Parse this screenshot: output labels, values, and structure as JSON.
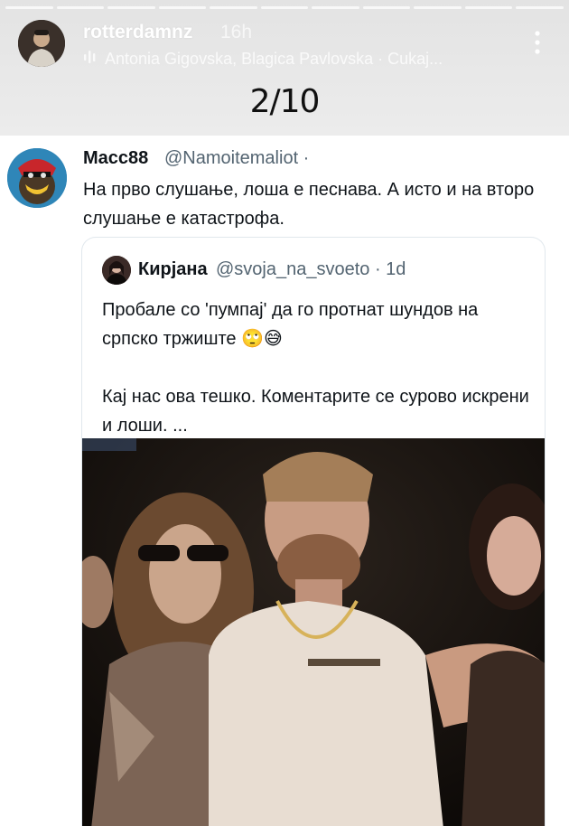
{
  "story": {
    "progress_segments": 11,
    "username": "rotterdamnz",
    "time": "16h",
    "music": "Antonia Gigovska, Blagica Pavlovska · Cukaj...",
    "counter": "2/10"
  },
  "tweet": {
    "display_name": "Macc88",
    "handle": "@Namoitemaliot ·",
    "text": "На прво слушање, лоша е песнава. А исто и на второ слушање е катастрофа.",
    "quote": {
      "display_name": "Кирјана",
      "handle": "@svoja_na_svoeto · 1d",
      "text_line1": "Пробале со 'пумпај' да го протнат шундов на српско тржиште 🙄😅",
      "text_line2": "Кај нас ова тешко. Коментарите се сурово искрени и лоши. ..."
    }
  }
}
